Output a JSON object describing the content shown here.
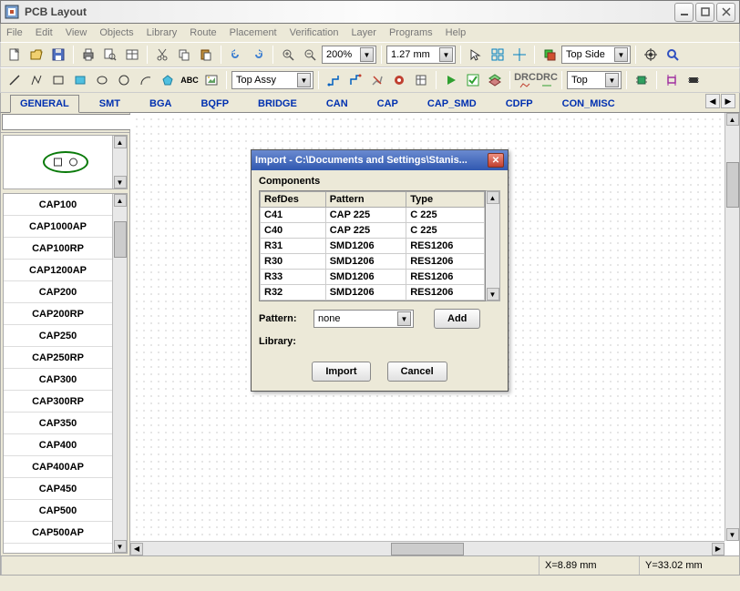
{
  "title": "PCB Layout",
  "menu": [
    "File",
    "Edit",
    "View",
    "Objects",
    "Library",
    "Route",
    "Placement",
    "Verification",
    "Layer",
    "Programs",
    "Help"
  ],
  "toolbar1": {
    "zoom": "200%",
    "grid": "1.27 mm",
    "layer": "Top Side"
  },
  "toolbar2": {
    "assembly": "Top Assy",
    "layer2": "Top"
  },
  "tabs": [
    "GENERAL",
    "SMT",
    "BGA",
    "BQFP",
    "BRIDGE",
    "CAN",
    "CAP",
    "CAP_SMD",
    "CDFP",
    "CON_MISC"
  ],
  "active_tab": 0,
  "parts": [
    "CAP100",
    "CAP1000AP",
    "CAP100RP",
    "CAP1200AP",
    "CAP200",
    "CAP200RP",
    "CAP250",
    "CAP250RP",
    "CAP300",
    "CAP300RP",
    "CAP350",
    "CAP400",
    "CAP400AP",
    "CAP450",
    "CAP500",
    "CAP500AP"
  ],
  "dialog": {
    "title": "Import  -  C:\\Documents and Settings\\Stanis...",
    "group": "Components",
    "cols": [
      "RefDes",
      "Pattern",
      "Type"
    ],
    "rows": [
      [
        "C41",
        "CAP 225",
        "C 225"
      ],
      [
        "C40",
        "CAP 225",
        "C 225"
      ],
      [
        "R31",
        "SMD1206",
        "RES1206"
      ],
      [
        "R30",
        "SMD1206",
        "RES1206"
      ],
      [
        "R33",
        "SMD1206",
        "RES1206"
      ],
      [
        "R32",
        "SMD1206",
        "RES1206"
      ]
    ],
    "pattern_label": "Pattern:",
    "pattern_value": "none",
    "add": "Add",
    "library_label": "Library:",
    "import": "Import",
    "cancel": "Cancel"
  },
  "status": {
    "x": "X=8.89 mm",
    "y": "Y=33.02 mm"
  }
}
